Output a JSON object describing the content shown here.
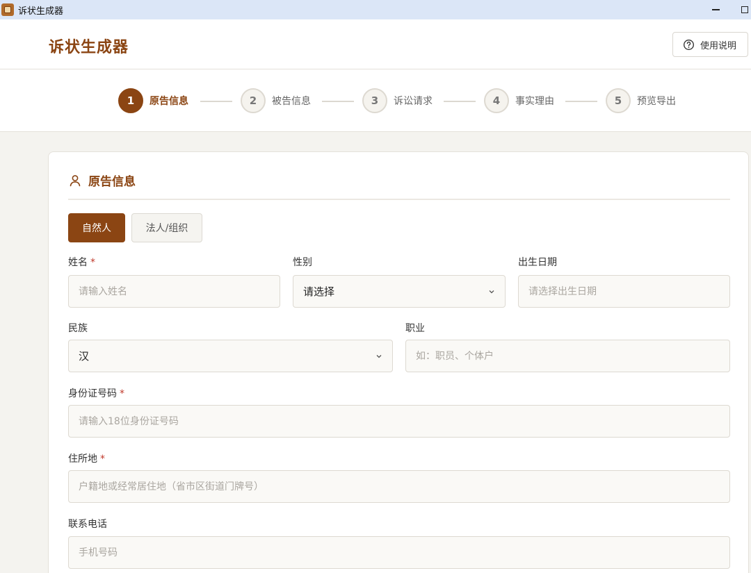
{
  "window": {
    "title": "诉状生成器",
    "app_icon": "gavel-app-icon",
    "minimize_icon": "minimize-icon",
    "maximize_icon": "maximize-icon"
  },
  "header": {
    "brand": "诉状生成器",
    "help_button": {
      "label": "使用说明",
      "icon": "question-circle-icon"
    }
  },
  "steps": [
    {
      "number": "1",
      "label": "原告信息",
      "active": true
    },
    {
      "number": "2",
      "label": "被告信息",
      "active": false
    },
    {
      "number": "3",
      "label": "诉讼请求",
      "active": false
    },
    {
      "number": "4",
      "label": "事实理由",
      "active": false
    },
    {
      "number": "5",
      "label": "预览导出",
      "active": false
    }
  ],
  "section": {
    "title": "原告信息",
    "icon": "user-icon"
  },
  "party_types": [
    {
      "label": "自然人",
      "selected": true
    },
    {
      "label": "法人/组织",
      "selected": false
    }
  ],
  "form": {
    "name": {
      "label": "姓名",
      "required": "*",
      "placeholder": "请输入姓名",
      "value": ""
    },
    "gender": {
      "label": "性别",
      "value": "请选择",
      "icon": "chevron-down-icon"
    },
    "birth_date": {
      "label": "出生日期",
      "placeholder": "请选择出生日期",
      "value": ""
    },
    "ethnicity": {
      "label": "民族",
      "value": "汉",
      "icon": "chevron-down-icon"
    },
    "occupation": {
      "label": "职业",
      "placeholder": "如：职员、个体户",
      "value": ""
    },
    "id_number": {
      "label": "身份证号码",
      "required": "*",
      "placeholder": "请输入18位身份证号码",
      "value": ""
    },
    "address": {
      "label": "住所地",
      "required": "*",
      "placeholder": "户籍地或经常居住地（省市区街道门牌号）",
      "value": ""
    },
    "phone": {
      "label": "联系电话",
      "placeholder": "手机号码",
      "value": ""
    }
  },
  "colors": {
    "accent": "#8b4513",
    "required": "#c0392b",
    "titlebar": "#dbe6f7",
    "page_bg": "#f4f3ef"
  }
}
